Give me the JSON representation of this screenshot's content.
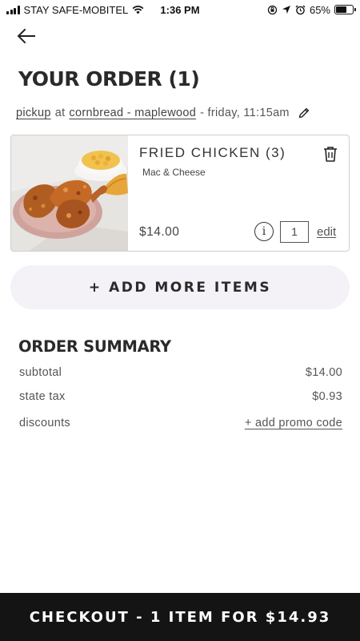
{
  "status_bar": {
    "carrier": "STAY SAFE-MOBITEL",
    "time": "1:36 PM",
    "battery_text": "65%",
    "battery_level": 0.65
  },
  "header": {
    "back_icon": "arrow-left-icon",
    "title": "YOUR ORDER (1)"
  },
  "order_info": {
    "mode": "pickup",
    "at_word": "at",
    "location": "cornbread - maplewood",
    "time_text": "- friday, 11:15am",
    "edit_icon": "pencil-icon"
  },
  "cart_items": [
    {
      "name": "FRIED CHICKEN (3)",
      "modifier": "Mac & Cheese",
      "price": "$14.00",
      "quantity": "1",
      "edit_label": "edit",
      "info_symbol": "i"
    }
  ],
  "add_more_label": "+ ADD MORE ITEMS",
  "summary": {
    "title": "ORDER SUMMARY",
    "subtotal_label": "subtotal",
    "subtotal_value": "$14.00",
    "tax_label": "state tax",
    "tax_value": "$0.93",
    "discounts_label": "discounts",
    "promo_label": "+ add promo code"
  },
  "checkout_label": "CHECKOUT - 1 ITEM FOR $14.93"
}
